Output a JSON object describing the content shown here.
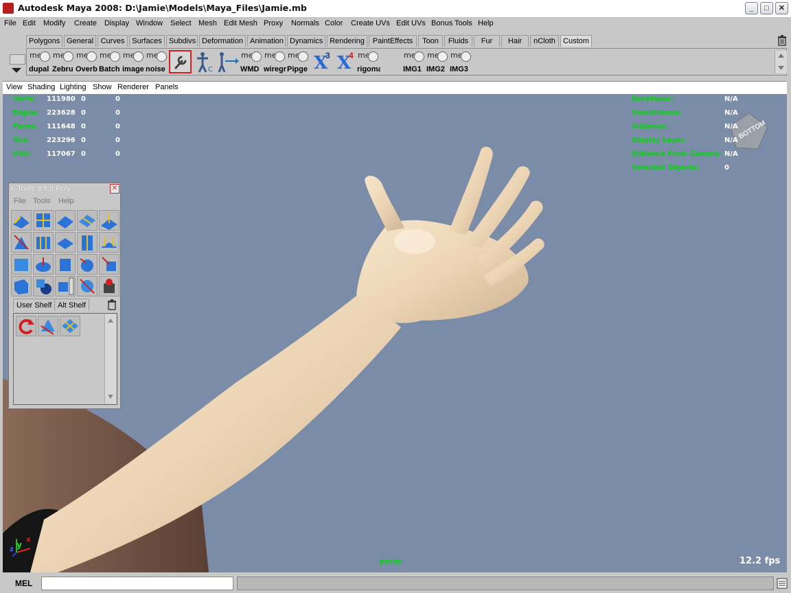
{
  "window": {
    "title": "Autodesk Maya 2008: D:\\Jamie\\Models\\Maya_Files\\Jamie.mb",
    "buttons": {
      "minimize": "_",
      "maximize": "□",
      "close": "✕"
    }
  },
  "menubar": [
    "File",
    "Edit",
    "Modify",
    "Create",
    "Display",
    "Window",
    "Select",
    "Mesh",
    "Edit Mesh",
    "Proxy",
    "Normals",
    "Color",
    "Create UVs",
    "Edit UVs",
    "Bonus Tools",
    "Help"
  ],
  "shelf_tabs": [
    "Polygons",
    "General",
    "Curves",
    "Surfaces",
    "Subdivs",
    "Deformation",
    "Animation",
    "Dynamics",
    "Rendering",
    "PaintEffects",
    "Toon",
    "Fluids",
    "Fur",
    "Hair",
    "nCloth",
    "Custom"
  ],
  "active_shelf_tab": "Custom",
  "shelf_buttons": [
    {
      "mel": "mel",
      "label": "dupal"
    },
    {
      "mel": "mel",
      "label": "Zebru"
    },
    {
      "mel": "mel",
      "label": "Overb"
    },
    {
      "mel": "mel",
      "label": "Batch"
    },
    {
      "mel": "mel",
      "label": "image"
    },
    {
      "mel": "mel",
      "label": "noise"
    },
    {
      "mel": "",
      "label": "",
      "icon": "wrench-icon"
    },
    {
      "mel": "",
      "label": "",
      "icon": "character-c-icon"
    },
    {
      "mel": "",
      "label": "",
      "icon": "character-arrow-icon"
    },
    {
      "mel": "mel",
      "label": "WMD"
    },
    {
      "mel": "mel",
      "label": "wiregr"
    },
    {
      "mel": "mel",
      "label": "Pipge"
    },
    {
      "mel": "",
      "label": "",
      "icon": "x3-icon",
      "text": "X",
      "num": "3"
    },
    {
      "mel": "",
      "label": "",
      "icon": "x4-icon",
      "text": "X",
      "num": "4"
    },
    {
      "mel": "mel",
      "label": "rigoma"
    },
    {
      "mel": "mel",
      "label": "IMG1"
    },
    {
      "mel": "mel",
      "label": "IMG2"
    },
    {
      "mel": "mel",
      "label": "IMG3"
    }
  ],
  "panel_menu": [
    "View",
    "Shading",
    "Lighting",
    "Show",
    "Renderer",
    "Panels"
  ],
  "hud_left": [
    {
      "label": "Verts:",
      "v1": "111980",
      "v2": "0",
      "v3": "0"
    },
    {
      "label": "Edges:",
      "v1": "223628",
      "v2": "0",
      "v3": "0"
    },
    {
      "label": "Faces:",
      "v1": "111648",
      "v2": "0",
      "v3": "0"
    },
    {
      "label": "Tris:",
      "v1": "223296",
      "v2": "0",
      "v3": "0"
    },
    {
      "label": "UVs:",
      "v1": "117067",
      "v2": "0",
      "v3": "0"
    }
  ],
  "hud_right": [
    {
      "label": "Backfaces:",
      "value": "N/A"
    },
    {
      "label": "Smoothness:",
      "value": "N/A"
    },
    {
      "label": "Instance:",
      "value": "N/A"
    },
    {
      "label": "Display Layer:",
      "value": "N/A"
    },
    {
      "label": "Distance From Camera:",
      "value": "N/A"
    },
    {
      "label": "Selected Objects:",
      "value": "0"
    }
  ],
  "view_cube_label": "BOTTOM",
  "camera_name": "persp",
  "fps": "12.2 fps",
  "axis": {
    "x": "x",
    "y": "y",
    "z": "z"
  },
  "xtools": {
    "title": "X-Tools 3.9.8 Poly",
    "menu": [
      "File",
      "Tools",
      "Help"
    ],
    "tabs": [
      "User Shelf",
      "Alt Shelf"
    ]
  },
  "command_line": {
    "label": "MEL",
    "value": ""
  },
  "colors": {
    "viewport": "#7a8ca8",
    "hud": "#0ecf18",
    "skin": "#f0dcc0"
  }
}
